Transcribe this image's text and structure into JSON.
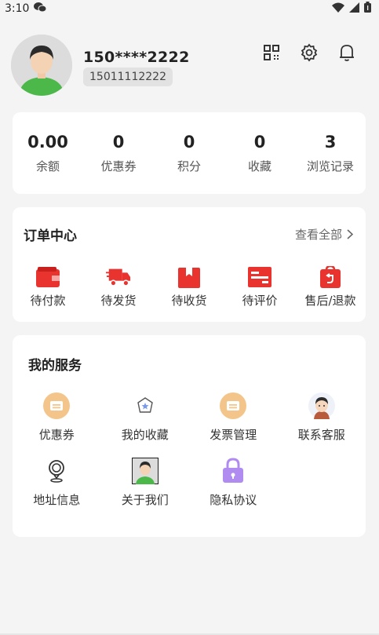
{
  "status_bar": {
    "time": "3:10"
  },
  "profile": {
    "masked_phone": "150****2222",
    "phone_number": "15011112222"
  },
  "stats": [
    {
      "value": "0.00",
      "label": "余额"
    },
    {
      "value": "0",
      "label": "优惠券"
    },
    {
      "value": "0",
      "label": "积分"
    },
    {
      "value": "0",
      "label": "收藏"
    },
    {
      "value": "3",
      "label": "浏览记录"
    }
  ],
  "orders": {
    "title": "订单中心",
    "view_all": "查看全部",
    "items": [
      {
        "label": "待付款",
        "icon": "wallet-icon"
      },
      {
        "label": "待发货",
        "icon": "delivery-truck-icon"
      },
      {
        "label": "待收货",
        "icon": "package-box-icon"
      },
      {
        "label": "待评价",
        "icon": "review-card-icon"
      },
      {
        "label": "售后/退款",
        "icon": "refund-bag-icon"
      }
    ]
  },
  "services": {
    "title": "我的服务",
    "items": [
      {
        "label": "优惠券",
        "icon": "coupon-icon"
      },
      {
        "label": "我的收藏",
        "icon": "star-favorite-icon"
      },
      {
        "label": "发票管理",
        "icon": "invoice-icon"
      },
      {
        "label": "联系客服",
        "icon": "customer-service-avatar-icon"
      },
      {
        "label": "地址信息",
        "icon": "location-pin-icon"
      },
      {
        "label": "关于我们",
        "icon": "about-avatar-icon"
      },
      {
        "label": "隐私协议",
        "icon": "privacy-lock-icon"
      }
    ]
  },
  "colors": {
    "accent_red": "#e8332f",
    "coupon_orange": "#f4c58a",
    "lock_purple": "#b18cf0"
  }
}
